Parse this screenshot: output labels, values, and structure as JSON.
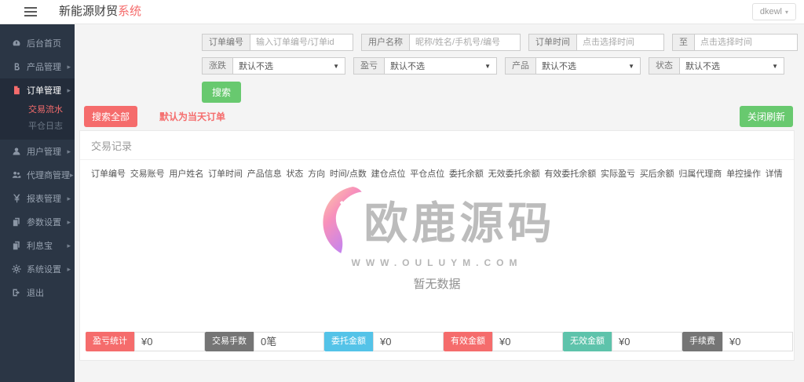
{
  "header": {
    "title_main": "新能源财贸",
    "title_accent": "系统",
    "user_label": "dkewl",
    "caret": "▾"
  },
  "sidebar": {
    "items": [
      {
        "label": "后台首页",
        "icon": "dashboard",
        "arrow": false,
        "active": false
      },
      {
        "label": "产品管理",
        "icon": "product",
        "arrow": true,
        "active": false
      },
      {
        "label": "订单管理",
        "icon": "order",
        "arrow": true,
        "active": true,
        "children": [
          {
            "label": "交易流水",
            "active": true
          },
          {
            "label": "平仓日志",
            "active": false
          }
        ]
      },
      {
        "label": "用户管理",
        "icon": "user",
        "arrow": true,
        "active": false
      },
      {
        "label": "代理商管理",
        "icon": "agents",
        "arrow": true,
        "active": false
      },
      {
        "label": "报表管理",
        "icon": "report",
        "arrow": true,
        "active": false
      },
      {
        "label": "参数设置",
        "icon": "params",
        "arrow": true,
        "active": false
      },
      {
        "label": "利息宝",
        "icon": "interest",
        "arrow": true,
        "active": false
      },
      {
        "label": "系统设置",
        "icon": "system",
        "arrow": true,
        "active": false
      },
      {
        "label": "退出",
        "icon": "logout",
        "arrow": false,
        "active": false
      }
    ]
  },
  "filters": {
    "row1": [
      {
        "label": "订单编号",
        "placeholder": "输入订单编号/订单id"
      },
      {
        "label": "用户名称",
        "placeholder": "昵称/姓名/手机号/编号"
      },
      {
        "label": "订单时间",
        "placeholder": "点击选择时间"
      },
      {
        "label": "至",
        "placeholder": "点击选择时间"
      }
    ],
    "row2": [
      {
        "label": "涨跌",
        "value": "默认不选"
      },
      {
        "label": "盈亏",
        "value": "默认不选"
      },
      {
        "label": "产品",
        "value": "默认不选"
      },
      {
        "label": "状态",
        "value": "默认不选"
      }
    ],
    "search_label": "搜索",
    "search_all_label": "搜索全部",
    "today_note": "默认为当天订单",
    "close_refresh_label": "关闭刷新"
  },
  "table": {
    "title": "交易记录",
    "columns": [
      "订单编号",
      "交易账号",
      "用户姓名",
      "订单时间",
      "产品信息",
      "状态",
      "方向",
      "时间/点数",
      "建仓点位",
      "平仓点位",
      "委托余额",
      "无效委托余额",
      "有效委托余额",
      "实际盈亏",
      "买后余额",
      "归属代理商",
      "单控操作",
      "详情"
    ],
    "empty_text": "暂无数据"
  },
  "watermark": {
    "brand": "欧鹿源码",
    "site": "WWW.OULUYM.COM"
  },
  "stats": [
    {
      "label": "盈亏统计",
      "value": "¥0",
      "color": "#f56c6c"
    },
    {
      "label": "交易手数",
      "value": "0笔",
      "color": "#757575"
    },
    {
      "label": "委托金额",
      "value": "¥0",
      "color": "#54c3e8"
    },
    {
      "label": "有效金额",
      "value": "¥0",
      "color": "#f56c6c"
    },
    {
      "label": "无效金额",
      "value": "¥0",
      "color": "#5ec3ab"
    },
    {
      "label": "手续费",
      "value": "¥0",
      "color": "#757575"
    }
  ],
  "colors": {
    "accent_red": "#f56c6c",
    "button_green": "#68c96f",
    "sidebar_bg": "#2b3645",
    "sidebar_active_bg": "#232c3a"
  }
}
